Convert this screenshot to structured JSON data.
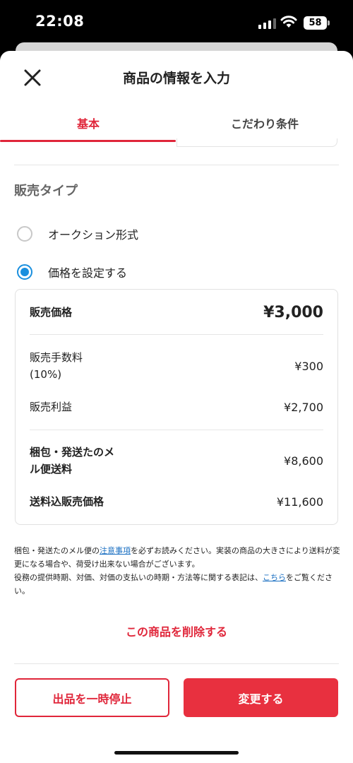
{
  "status_bar": {
    "time": "22:08",
    "battery": "58"
  },
  "header": {
    "title": "商品の情報を入力"
  },
  "tabs": [
    {
      "label": "基本",
      "active": true
    },
    {
      "label": "こだわり条件",
      "active": false
    }
  ],
  "sale_type": {
    "label": "販売タイプ",
    "options": [
      {
        "label": "オークション形式",
        "selected": false
      },
      {
        "label": "価格を設定する",
        "selected": true
      }
    ]
  },
  "price_card": {
    "sale_price_label": "販売価格",
    "sale_price_value": "¥3,000",
    "fee_label_1": "販売手数料",
    "fee_label_2": "(10%)",
    "fee_value": "¥300",
    "profit_label": "販売利益",
    "profit_value": "¥2,700",
    "shipping_label_1": "梱包・発送たのメ",
    "shipping_label_2": "ル便送料",
    "shipping_value": "¥8,600",
    "total_label": "送料込販売価格",
    "total_value": "¥11,600"
  },
  "notice": {
    "part1": "梱包・発送たのメル便の",
    "link1": "注意事項",
    "part2": "を必ずお読みください。実装の商品の大きさにより送料が変更になる場合や、荷受け出来ない場合がございます。",
    "part3": "役務の提供時期、対価、対価の支払いの時期・方法等に関する表記は、",
    "link2": "こちら",
    "part4": "をご覧ください。"
  },
  "delete_label": "この商品を削除する",
  "buttons": {
    "pause": "出品を一時停止",
    "update": "変更する"
  },
  "colors": {
    "accent": "#e0263a",
    "radio": "#1a8fde",
    "link": "#1a6fc2"
  }
}
